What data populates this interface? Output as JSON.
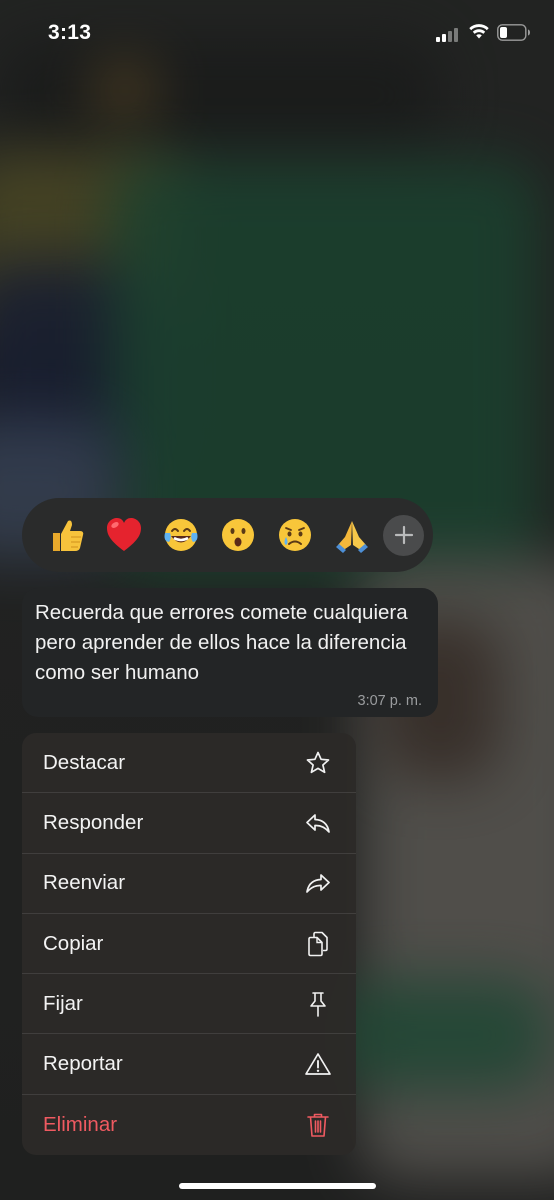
{
  "status_bar": {
    "time": "3:13",
    "signal_bars": 2,
    "battery_level": 0.25
  },
  "reactions": {
    "emojis": [
      {
        "glyph": "👍",
        "name": "thumbs-up"
      },
      {
        "glyph": "❤️",
        "name": "red-heart"
      },
      {
        "glyph": "😂",
        "name": "face-with-tears-of-joy"
      },
      {
        "glyph": "😮",
        "name": "face-with-open-mouth"
      },
      {
        "glyph": "😢",
        "name": "crying-face"
      },
      {
        "glyph": "🙏",
        "name": "folded-hands"
      }
    ],
    "add_icon": "plus-icon"
  },
  "message": {
    "text": "Recuerda que errores comete cualquiera pero aprender de ellos hace la diferencia como ser humano",
    "time": "3:07 p. m."
  },
  "menu": {
    "items": [
      {
        "label": "Destacar",
        "icon": "star-icon"
      },
      {
        "label": "Responder",
        "icon": "reply-icon"
      },
      {
        "label": "Reenviar",
        "icon": "forward-icon"
      },
      {
        "label": "Copiar",
        "icon": "copy-icon"
      },
      {
        "label": "Fijar",
        "icon": "pin-icon"
      },
      {
        "label": "Reportar",
        "icon": "warning-icon"
      },
      {
        "label": "Eliminar",
        "icon": "trash-icon"
      }
    ],
    "danger_color": "#ef5a61"
  }
}
